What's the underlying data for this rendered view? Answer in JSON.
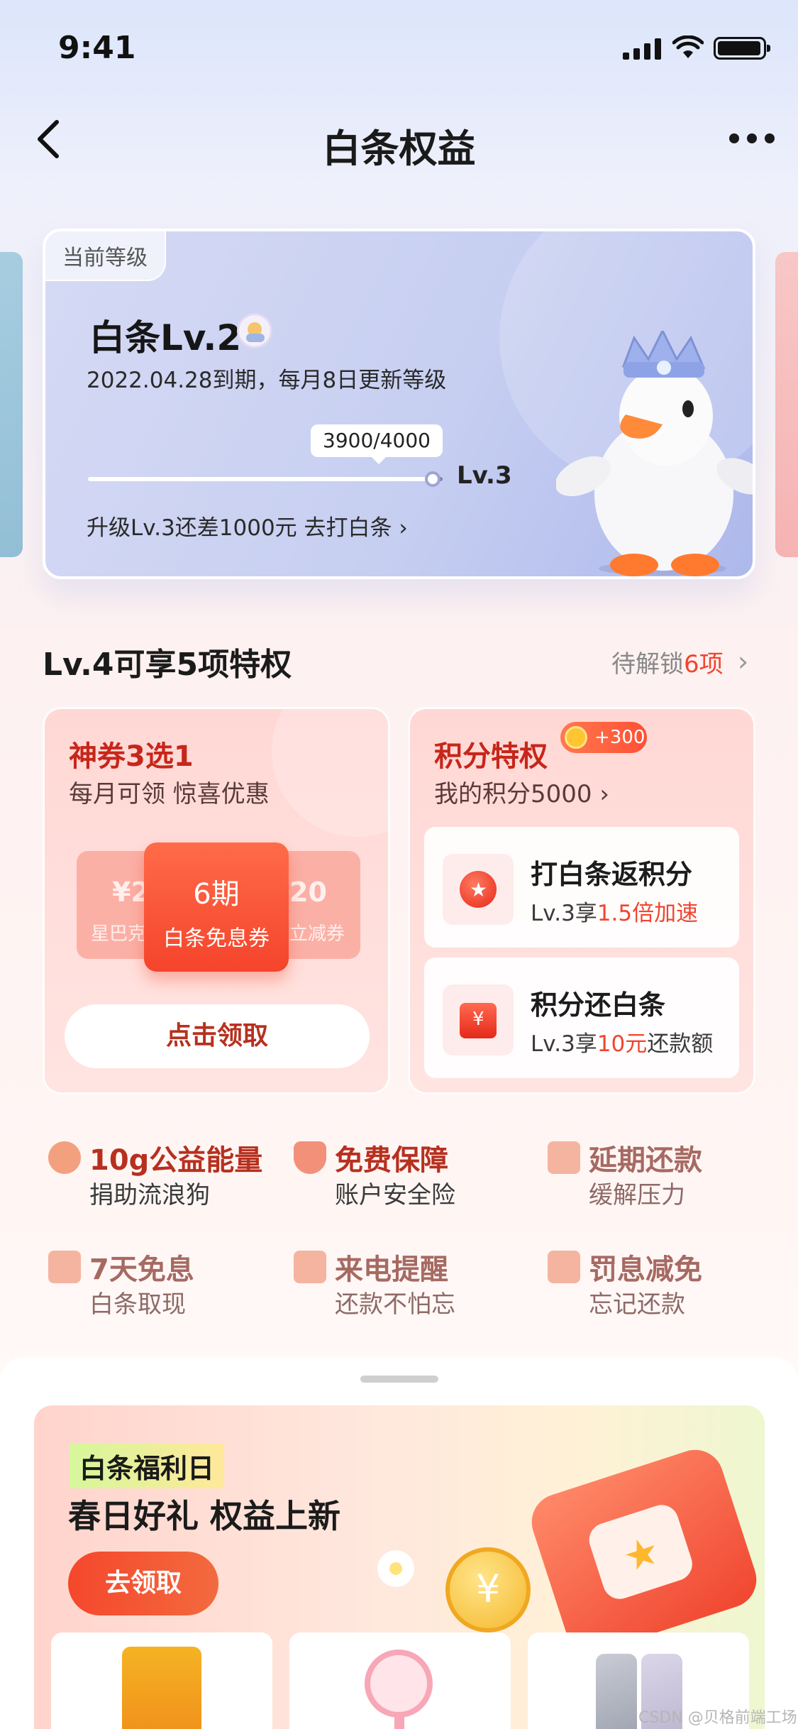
{
  "status_bar": {
    "time": "9:41"
  },
  "nav": {
    "title": "白条权益",
    "back_icon": "chevron-left-icon",
    "more_icon": "more-dots-icon"
  },
  "level_card": {
    "tag": "当前等级",
    "level_name": "白条Lv.2",
    "expire_text": "2022.04.28到期，每月8日更新等级",
    "progress_text": "3900/4000",
    "progress_value": 0.975,
    "next_level": "Lv.3",
    "upgrade_text": "升级Lv.3还差1000元 去打白条"
  },
  "privileges": {
    "title": "Lv.4可享5项特权",
    "pending_prefix": "待解锁",
    "pending_count": "6项"
  },
  "coupon_card": {
    "title": "神券3选1",
    "subtitle": "每月可领 惊喜优惠",
    "back_left_big": "¥2",
    "back_left_small": "星巴克",
    "back_right_big": "20",
    "back_right_small": "立减券",
    "front_big": "6期",
    "front_small": "白条免息券",
    "button": "点击领取"
  },
  "points_card": {
    "title": "积分特权",
    "badge": "+300",
    "subtitle": "我的积分5000",
    "tiles": [
      {
        "title": "打白条返积分",
        "sub_prefix": "Lv.3享",
        "sub_highlight": "1.5倍加速",
        "sub_suffix": ""
      },
      {
        "title": "积分还白条",
        "sub_prefix": "Lv.3享",
        "sub_highlight": "10元",
        "sub_suffix": "还款额"
      }
    ]
  },
  "features": [
    {
      "title": "10g公益能量",
      "sub": "捐助流浪狗",
      "icon": "dog-icon"
    },
    {
      "title": "免费保障",
      "sub": "账户安全险",
      "icon": "shield-icon"
    },
    {
      "title": "延期还款",
      "sub": "缓解压力",
      "icon": "card-lock-icon"
    },
    {
      "title": "7天免息",
      "sub": "白条取现",
      "icon": "yuan-lock-icon"
    },
    {
      "title": "来电提醒",
      "sub": "还款不怕忘",
      "icon": "phone-lock-icon"
    },
    {
      "title": "罚息减免",
      "sub": "忘记还款",
      "icon": "doc-lock-icon"
    }
  ],
  "banner": {
    "tag": "白条福利日",
    "title": "春日好礼 权益上新",
    "button": "去领取"
  },
  "watermark": "CSDN @贝格前端工场",
  "colors": {
    "accent": "#f0452f",
    "feature_title": "#b7301f"
  }
}
